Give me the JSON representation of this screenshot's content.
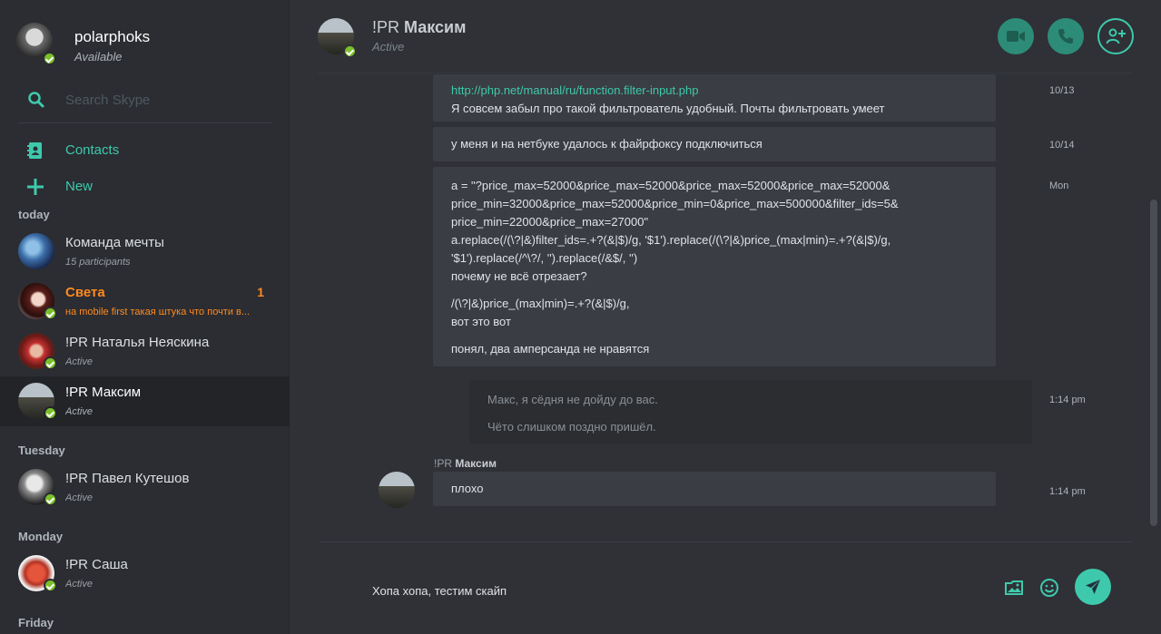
{
  "profile": {
    "name": "polarphoks",
    "status": "Available"
  },
  "search": {
    "placeholder": "Search Skype"
  },
  "nav": {
    "contacts_label": "Contacts",
    "new_label": "New"
  },
  "sections": {
    "today": "today",
    "tuesday": "Tuesday",
    "monday": "Monday",
    "friday": "Friday"
  },
  "contacts": [
    {
      "name": "Команда мечты",
      "sub": "15 participants"
    },
    {
      "name": "Света",
      "sub": "на mobile first такая штука что почти в...",
      "badge": "1"
    },
    {
      "name": "!PR Наталья Неяскина",
      "sub": "Active"
    },
    {
      "name": "!PR Максим",
      "sub": "Active"
    },
    {
      "name": "!PR Павел Кутешов",
      "sub": "Active"
    },
    {
      "name": "!PR Саша",
      "sub": "Active"
    }
  ],
  "chat": {
    "prefix": "!PR",
    "name": "Максим",
    "status": "Active"
  },
  "messages": [
    {
      "lines": [
        "http://php.net/manual/ru/function.filter-input.php",
        "Я совсем забыл про такой фильтрователь удобный. Почты фильтровать умеет"
      ],
      "time": "10/13"
    },
    {
      "lines": [
        "у меня и на нетбуке удалось к файрфоксу подключиться"
      ],
      "time": "10/14"
    },
    {
      "lines": [
        "a = \"?price_max=52000&price_max=52000&price_max=52000&price_max=52000&",
        "price_min=32000&price_max=52000&price_min=0&price_max=500000&filter_ids=5&",
        "price_min=22000&price_max=27000\"",
        "a.replace(/(\\?|&)filter_ids=.+?(&|$)/g, '$1').replace(/(\\?|&)price_(max|min)=.+?(&|$)/g,",
        "'$1').replace(/^\\?/, '').replace(/&$/, '')",
        "почему не всё отрезает?",
        "/(\\?|&)price_(max|min)=.+?(&|$)/g,",
        "вот это вот",
        "понял, два амперсанда не нравятся"
      ],
      "time": "Mon"
    },
    {
      "lines": [
        "Макс, я сёдня не дойду до вас.",
        "Чёто слишком поздно пришёл."
      ],
      "time": "1:14 pm"
    },
    {
      "sender_prefix": "!PR",
      "sender_name": "Максим",
      "lines": [
        "плохо"
      ],
      "time": "1:14 pm"
    }
  ],
  "composer": {
    "value": "Хопа хопа, тестим скайп"
  },
  "colors": {
    "accent": "#3ec9ac",
    "unread": "#ff8a1f",
    "online": "#7bbf2a"
  },
  "icons": [
    "search-icon",
    "contacts-icon",
    "plus-icon",
    "video-call-icon",
    "phone-icon",
    "add-person-icon",
    "media-icon",
    "emoji-icon",
    "send-icon"
  ]
}
